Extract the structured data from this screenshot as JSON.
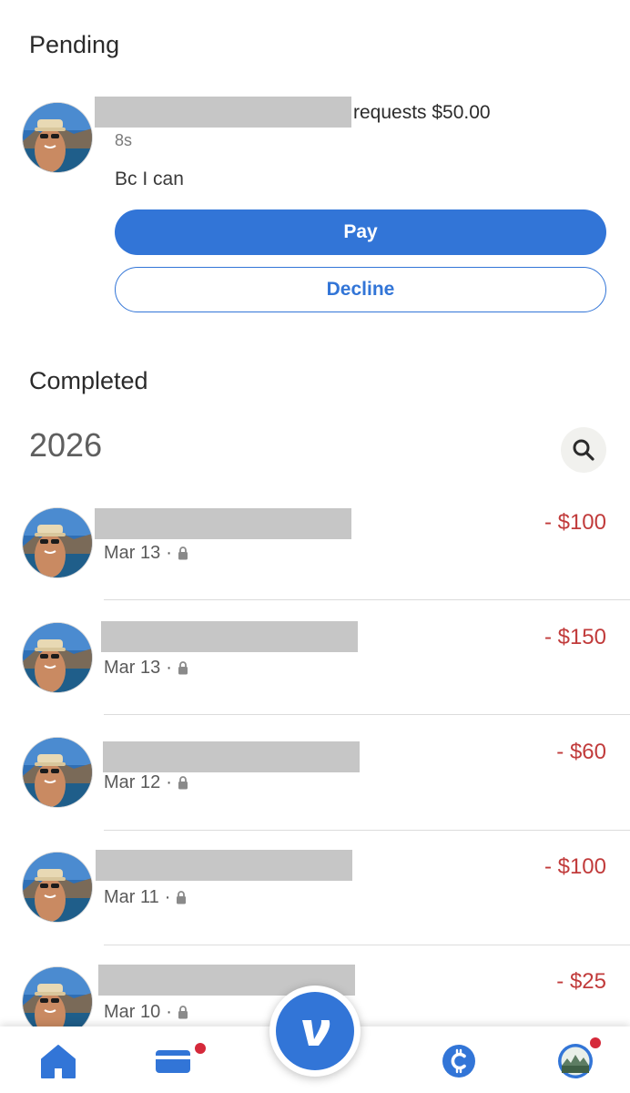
{
  "pending": {
    "title": "Pending",
    "request": {
      "action_text": "requests $50.00",
      "time_ago": "8s",
      "note": "Bc I can",
      "pay_label": "Pay",
      "decline_label": "Decline"
    }
  },
  "completed": {
    "title": "Completed",
    "year": "2026",
    "search_icon": "search-icon",
    "transactions": [
      {
        "date": "Mar 13",
        "amount": "- $100",
        "privacy_icon": "lock-icon"
      },
      {
        "date": "Mar 13",
        "amount": "- $150",
        "privacy_icon": "lock-icon"
      },
      {
        "date": "Mar 12",
        "amount": "- $60",
        "privacy_icon": "lock-icon"
      },
      {
        "date": "Mar 11",
        "amount": "- $100",
        "privacy_icon": "lock-icon"
      },
      {
        "date": "Mar 10",
        "amount": "- $25",
        "privacy_icon": "lock-icon"
      }
    ],
    "date_separator": "·"
  },
  "nav": {
    "items": [
      "home-icon",
      "card-icon",
      "venmo-logo-icon",
      "crypto-icon",
      "profile-avatar"
    ],
    "badges_on": [
      "card-icon",
      "profile-avatar"
    ],
    "venmo_letter": "v"
  },
  "colors": {
    "accent": "#3275d7",
    "debit": "#c13b3b",
    "badge": "#d5293a",
    "redaction": "#c6c6c6"
  }
}
